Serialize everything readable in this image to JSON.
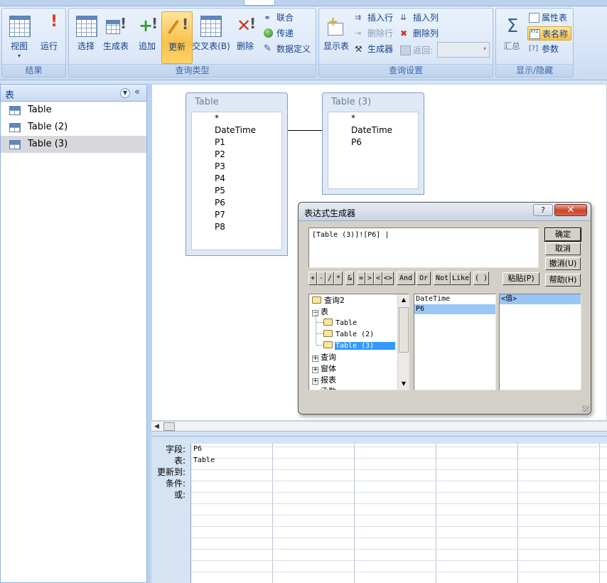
{
  "ribbon": {
    "groups": {
      "results": "结果",
      "query_type": "查询类型",
      "query_setup": "查询设置",
      "show_hide": "显示/隐藏"
    },
    "buttons": {
      "view": "视图",
      "run": "运行",
      "select": "选择",
      "make_table": "生成表",
      "append": "追加",
      "update": "更新",
      "crosstab": "交叉表(B)",
      "delete": "删除",
      "union": "联合",
      "pass_through": "传递",
      "data_definition": "数据定义",
      "show_table": "显示表",
      "insert_rows": "插入行",
      "delete_rows": "删除行",
      "builder": "生成器",
      "insert_columns": "插入列",
      "delete_columns": "删除列",
      "return": "返回:",
      "totals": "汇总",
      "property_sheet": "属性表",
      "table_names": "表名称",
      "parameters": "参数"
    },
    "selected_button": "update"
  },
  "nav_pane": {
    "title": "表",
    "items": [
      "Table",
      "Table (2)",
      "Table (3)"
    ],
    "selected_index": 2
  },
  "design": {
    "tables": [
      {
        "title": "Table",
        "fields": [
          "*",
          "DateTime",
          "P1",
          "P2",
          "P3",
          "P4",
          "P5",
          "P6",
          "P7",
          "P8"
        ]
      },
      {
        "title": "Table (3)",
        "fields": [
          "*",
          "DateTime",
          "P6"
        ]
      }
    ]
  },
  "dialog": {
    "title": "表达式生成器",
    "help_glyph": "?",
    "close_glyph": "✕",
    "expression": "[Table (3)]![P6] |",
    "buttons": {
      "ok": "确定",
      "cancel": "取消",
      "undo": "撤消(U)",
      "help": "帮助(H)",
      "paste": "粘贴(P)"
    },
    "operators": [
      "+",
      "-",
      "/",
      "*",
      "&",
      "=",
      ">",
      "<",
      "<>",
      "And",
      "Or",
      "Not",
      "Like",
      "( )"
    ],
    "tree": {
      "items": [
        {
          "label": "查询2",
          "kind": "folder"
        },
        {
          "label": "表",
          "kind": "minus"
        },
        {
          "label": "Table",
          "kind": "child-folder"
        },
        {
          "label": "Table (2)",
          "kind": "child-folder"
        },
        {
          "label": "Table (3)",
          "kind": "child-folder-open",
          "selected": true
        },
        {
          "label": "查询",
          "kind": "plus"
        },
        {
          "label": "窗体",
          "kind": "plus"
        },
        {
          "label": "报表",
          "kind": "plus"
        },
        {
          "label": "函数",
          "kind": "plus"
        }
      ]
    },
    "middle_list": [
      "DateTime",
      "P6"
    ],
    "middle_selected": 1,
    "right_list": [
      "<值>"
    ],
    "right_selected": 0
  },
  "grid": {
    "row_labels": [
      "字段:",
      "表:",
      "更新到:",
      "条件:",
      "或:"
    ],
    "columns": [
      {
        "field": "P6",
        "table": "Table"
      }
    ]
  }
}
